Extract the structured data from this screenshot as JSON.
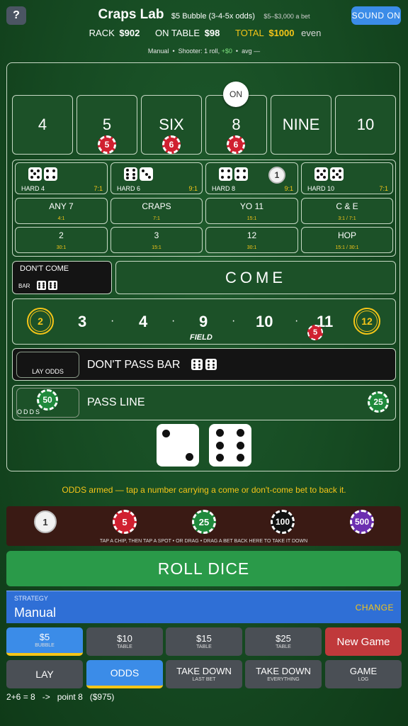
{
  "header": {
    "help_label": "?",
    "title": "Craps Lab",
    "bubble_info": "$5 Bubble (3-4-5x odds)",
    "limits": "$5–$3,000 a bet",
    "sound_label": "SOUND  ON",
    "rack_label": "RACK",
    "rack_value": "$902",
    "on_table_label": "ON TABLE",
    "on_table_value": "$98",
    "total_label": "TOTAL",
    "total_value": "$1000",
    "total_note": "even",
    "status_mode": "Manual",
    "status_shooter": "Shooter: 1 roll,",
    "status_delta": "+$0",
    "status_avg": "avg —"
  },
  "table": {
    "puck_label": "ON",
    "place_numbers": [
      "4",
      "5",
      "SIX",
      "8",
      "NINE",
      "10"
    ],
    "place_chips": [
      {
        "label": "5"
      },
      {
        "label": "6"
      },
      {
        "label": "6"
      }
    ],
    "hardways": [
      {
        "label": "HARD 4",
        "odds": "7:1"
      },
      {
        "label": "HARD 6",
        "odds": "9:1"
      },
      {
        "label": "HARD 8",
        "odds": "9:1",
        "chip": "1"
      },
      {
        "label": "HARD 10",
        "odds": "7:1"
      }
    ],
    "props_row1": [
      {
        "name": "ANY 7",
        "odds": "4:1"
      },
      {
        "name": "CRAPS",
        "odds": "7:1"
      },
      {
        "name": "YO 11",
        "odds": "15:1"
      },
      {
        "name": "C & E",
        "odds": "3:1 / 7:1"
      }
    ],
    "props_row2": [
      {
        "name": "2",
        "odds": "30:1"
      },
      {
        "name": "3",
        "odds": "15:1"
      },
      {
        "name": "12",
        "odds": "30:1"
      },
      {
        "name": "HOP",
        "odds": "15:1 / 30:1"
      }
    ],
    "dont_come_label": "DON'T COME",
    "dont_come_bar": "BAR",
    "come_label": "COME",
    "field_numbers": [
      "3",
      "4",
      "9",
      "10",
      "11"
    ],
    "field_dot": "·",
    "field_label": "FIELD",
    "field_ring_left": "2",
    "field_ring_right": "12",
    "field_chip": "5",
    "lay_odds_label": "LAY  ODDS",
    "dont_pass_label": "DON'T PASS BAR",
    "odds_label": "ODDS",
    "odds_chip": "50",
    "pass_label": "PASS  LINE",
    "pass_chip": "25",
    "dice": [
      2,
      6
    ]
  },
  "message": "ODDS armed — tap a number carrying a come or don't-come bet to back it.",
  "chip_tray": {
    "chips": [
      {
        "label": "1",
        "color": "#f2f2f2"
      },
      {
        "label": "5",
        "color": "#d02030"
      },
      {
        "label": "25",
        "color": "#1f8a3c"
      },
      {
        "label": "100",
        "color": "#111111"
      },
      {
        "label": "500",
        "color": "#6c2fb0"
      }
    ],
    "hint": "TAP A CHIP, THEN TAP A SPOT  •  OR DRAG  •  DRAG A BET BACK HERE TO TAKE IT DOWN"
  },
  "roll_label": "ROLL  DICE",
  "strategy": {
    "caption": "STRATEGY",
    "value": "Manual",
    "change_label": "CHANGE"
  },
  "table_minimums": [
    {
      "main": "$5",
      "sub": "BUBBLE",
      "selected": true
    },
    {
      "main": "$10",
      "sub": "TABLE"
    },
    {
      "main": "$15",
      "sub": "TABLE"
    },
    {
      "main": "$25",
      "sub": "TABLE"
    }
  ],
  "new_game_label": "New Game",
  "actions": [
    {
      "main": "LAY",
      "sub": ""
    },
    {
      "main": "ODDS",
      "sub": "",
      "selected": true
    },
    {
      "main": "TAKE DOWN",
      "sub": "LAST BET"
    },
    {
      "main": "TAKE DOWN",
      "sub": "EVERYTHING"
    },
    {
      "main": "GAME",
      "sub": "LOG"
    }
  ],
  "roll_log": "2+6 = 8   ->   point 8   ($975)",
  "colors": {
    "felt": "#1c5128",
    "accent_gold": "#f5c518",
    "button_blue": "#3b8ce8",
    "roll_green": "#2a9a49",
    "new_game_red": "#c0393b",
    "chip_red": "#d02030",
    "chip_green": "#1f8a3c"
  }
}
